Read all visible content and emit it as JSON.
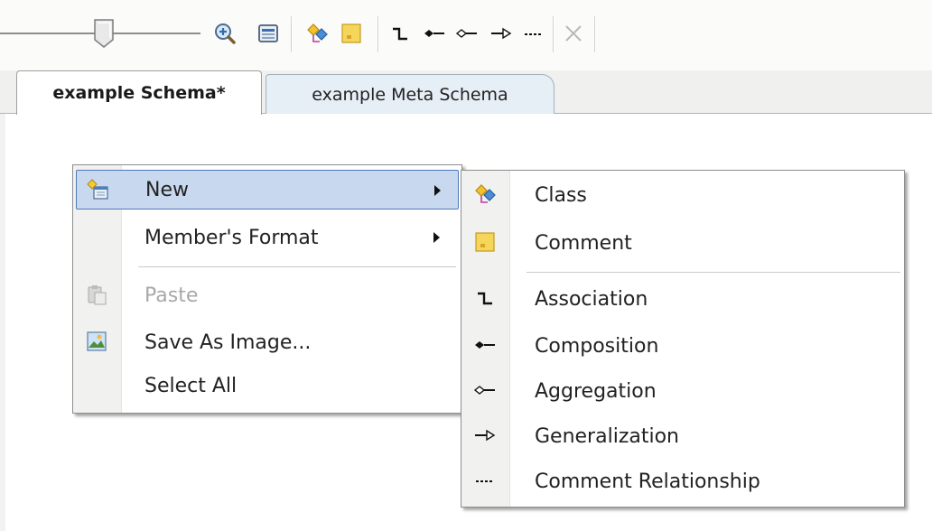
{
  "toolbar": {
    "zoom_slider_percent": 48,
    "buttons": [
      {
        "name": "zoom-in-icon"
      },
      {
        "name": "fit-view-icon"
      },
      {
        "name": "new-class-icon"
      },
      {
        "name": "new-comment-icon"
      },
      {
        "name": "association-icon"
      },
      {
        "name": "composition-icon"
      },
      {
        "name": "aggregation-icon"
      },
      {
        "name": "generalization-icon"
      },
      {
        "name": "comment-relationship-icon"
      },
      {
        "name": "delete-icon"
      }
    ]
  },
  "tabs": [
    {
      "label": "example Schema*",
      "active": true
    },
    {
      "label": "example Meta Schema",
      "active": false
    }
  ],
  "context_menu": {
    "items": [
      {
        "label": "New",
        "icon": "new-icon",
        "submenu": true,
        "highlighted": true
      },
      {
        "label": "Member's Format",
        "submenu": true
      },
      {
        "label": "Paste",
        "icon": "paste-icon",
        "disabled": true
      },
      {
        "label": "Save As Image...",
        "icon": "image-icon"
      },
      {
        "label": "Select All"
      }
    ]
  },
  "submenu": {
    "items": [
      {
        "label": "Class",
        "icon": "class-icon"
      },
      {
        "label": "Comment",
        "icon": "comment-icon"
      },
      {
        "label": "Association",
        "icon": "association-icon"
      },
      {
        "label": "Composition",
        "icon": "composition-icon"
      },
      {
        "label": "Aggregation",
        "icon": "aggregation-icon"
      },
      {
        "label": "Generalization",
        "icon": "generalization-icon"
      },
      {
        "label": "Comment Relationship",
        "icon": "comment-relationship-icon"
      }
    ]
  },
  "colors": {
    "highlight_bg": "#c8d9ef",
    "highlight_border": "#4e79b7",
    "class_icon_yellow": "#f2c230",
    "class_icon_blue": "#4a8fd6",
    "comment_icon_yellow": "#f6d65a"
  }
}
